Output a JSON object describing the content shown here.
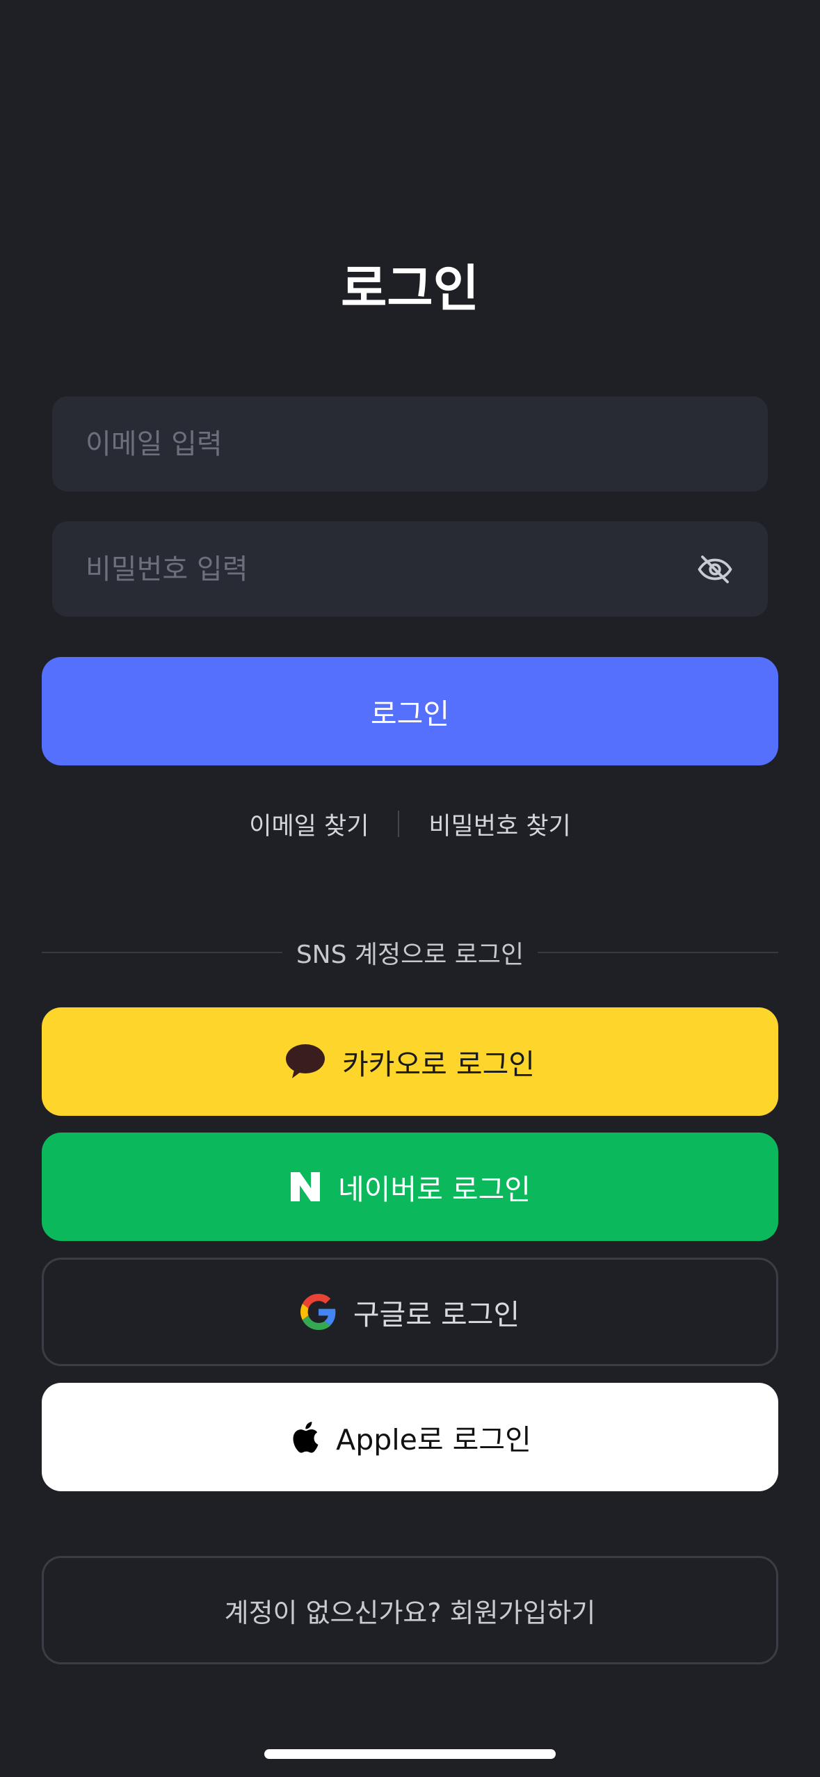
{
  "page": {
    "title": "로그인"
  },
  "form": {
    "email_placeholder": "이메일 입력",
    "password_placeholder": "비밀번호 입력",
    "login_button": "로그인"
  },
  "links": {
    "find_email": "이메일 찾기",
    "find_password": "비밀번호 찾기"
  },
  "sns": {
    "divider_text": "SNS 계정으로 로그인",
    "kakao": {
      "label": "카카오로 로그인",
      "color": "#fed52a",
      "icon": "kakao-talk-icon"
    },
    "naver": {
      "label": "네이버로 로그인",
      "color": "#0bb85b",
      "icon": "naver-n-icon"
    },
    "google": {
      "label": "구글로 로그인",
      "icon": "google-g-icon"
    },
    "apple": {
      "label": "Apple로 로그인",
      "color": "#ffffff",
      "icon": "apple-icon"
    }
  },
  "signup": {
    "label": "계정이 없으신가요? 회원가입하기"
  },
  "colors": {
    "background": "#1f2025",
    "field": "#292b34",
    "accent": "#5570fc"
  }
}
